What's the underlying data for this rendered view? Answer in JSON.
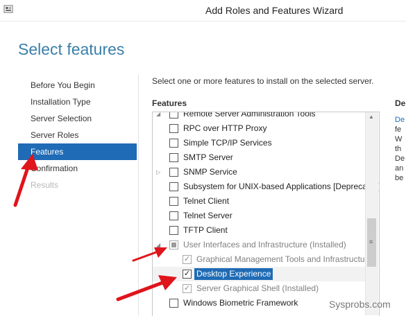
{
  "window": {
    "title": "Add Roles and Features Wizard"
  },
  "page": {
    "heading": "Select features"
  },
  "nav": {
    "items": [
      {
        "label": "Before You Begin",
        "state": "normal"
      },
      {
        "label": "Installation Type",
        "state": "normal"
      },
      {
        "label": "Server Selection",
        "state": "normal"
      },
      {
        "label": "Server Roles",
        "state": "normal"
      },
      {
        "label": "Features",
        "state": "active"
      },
      {
        "label": "Confirmation",
        "state": "normal"
      },
      {
        "label": "Results",
        "state": "disabled"
      }
    ]
  },
  "main": {
    "instruction": "Select one or more features to install on the selected server.",
    "features_header": "Features",
    "description_header": "De",
    "description_fragments": [
      "De",
      "fe",
      "W",
      "th",
      "De",
      "an",
      "be"
    ]
  },
  "features": [
    {
      "label": "Remote Server Administration Tools",
      "checked": false,
      "level": 0
    },
    {
      "label": "RPC over HTTP Proxy",
      "checked": false,
      "level": 0
    },
    {
      "label": "Simple TCP/IP Services",
      "checked": false,
      "level": 0
    },
    {
      "label": "SMTP Server",
      "checked": false,
      "level": 0
    },
    {
      "label": "SNMP Service",
      "checked": false,
      "level": 0
    },
    {
      "label": "Subsystem for UNIX-based Applications [Deprecated]",
      "checked": false,
      "level": 0
    },
    {
      "label": "Telnet Client",
      "checked": false,
      "level": 0
    },
    {
      "label": "Telnet Server",
      "checked": false,
      "level": 0
    },
    {
      "label": "TFTP Client",
      "checked": false,
      "level": 0
    },
    {
      "label": "User Interfaces and Infrastructure (Installed)",
      "checked": "partial",
      "level": 0
    },
    {
      "label": "Graphical Management Tools and Infrastructure",
      "checked": true,
      "level": 1
    },
    {
      "label": "Desktop Experience",
      "checked": true,
      "level": 1
    },
    {
      "label": "Server Graphical Shell (Installed)",
      "checked": true,
      "level": 1
    },
    {
      "label": "Windows Biometric Framework",
      "checked": false,
      "level": 0
    }
  ],
  "icons": {
    "expand_collapsed": "triangle-right-icon",
    "expand_open": "triangle-down-icon",
    "app": "server-manager-icon"
  },
  "colors": {
    "accent": "#1f6bb5",
    "heading": "#3a7fa8",
    "annotation_arrow": "#e0141b"
  },
  "watermark": "Sysprobs.com"
}
